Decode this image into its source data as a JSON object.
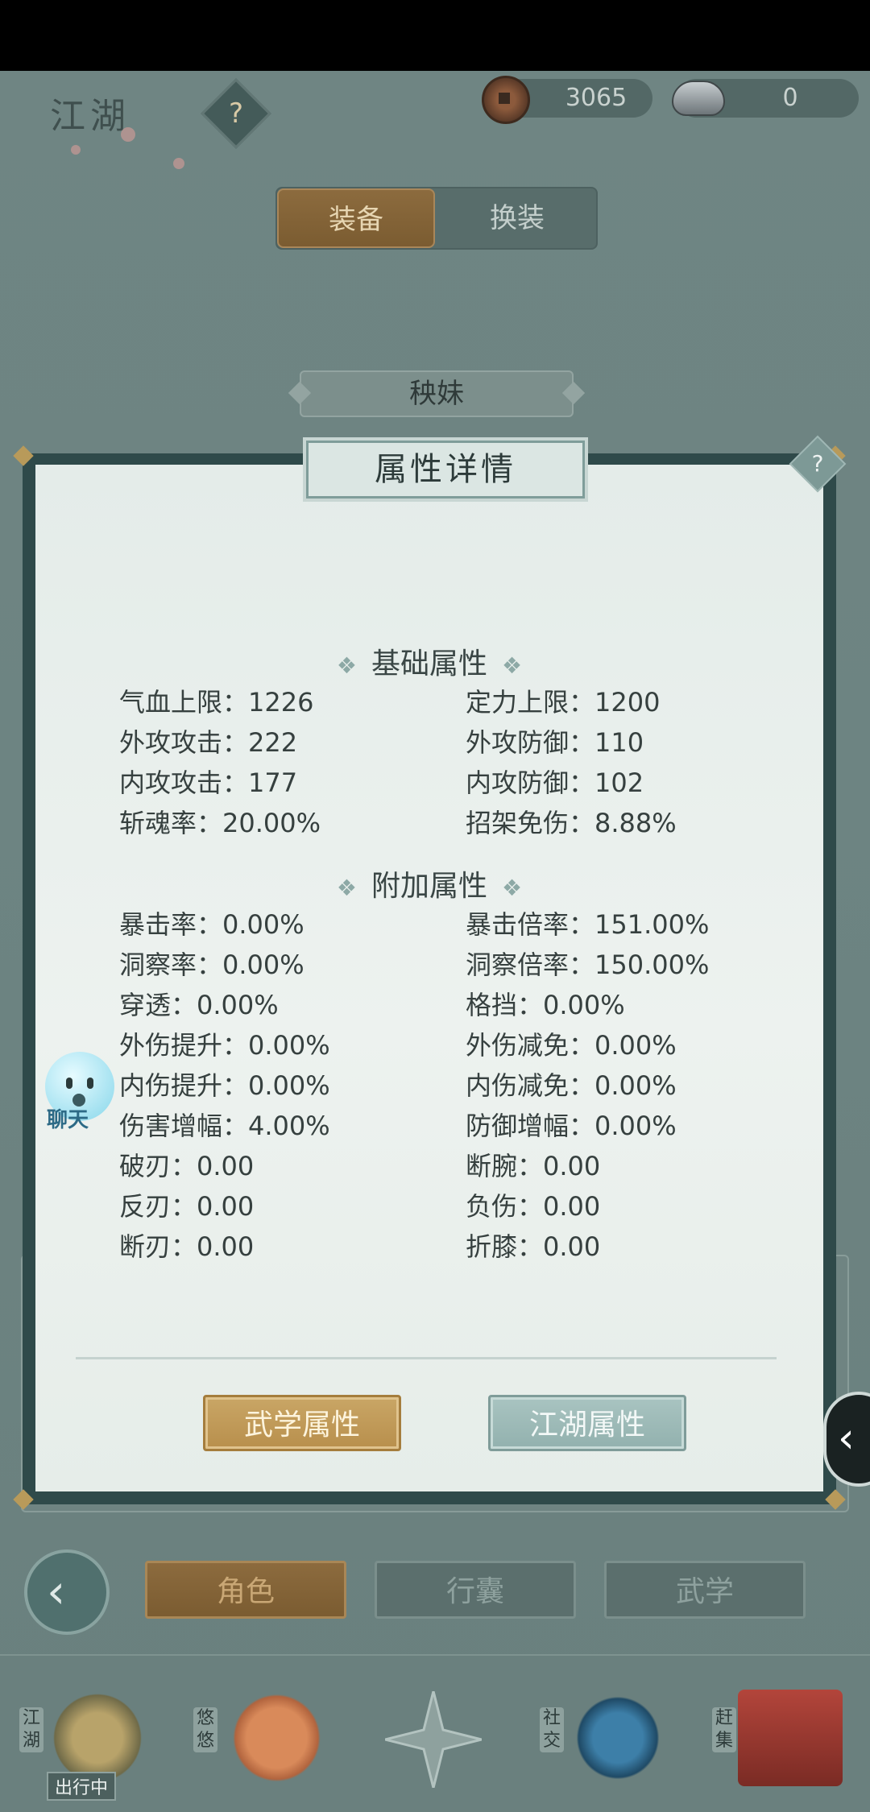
{
  "header": {
    "title": "江湖",
    "help_icon": "?",
    "copper": "3065",
    "silver": "0"
  },
  "tabs": [
    {
      "label": "装备",
      "active": true
    },
    {
      "label": "换装",
      "active": false
    }
  ],
  "character_name": "秧妹",
  "modal": {
    "title": "属性详情",
    "help": "?",
    "basic_title": "基础属性",
    "basic_stats": [
      {
        "label": "气血上限：1226"
      },
      {
        "label": "定力上限：1200"
      },
      {
        "label": "外攻攻击：222"
      },
      {
        "label": "外攻防御：110"
      },
      {
        "label": "内攻攻击：177"
      },
      {
        "label": "内攻防御：102"
      },
      {
        "label": "斩魂率：20.00%"
      },
      {
        "label": "招架免伤：8.88%"
      }
    ],
    "extra_title": "附加属性",
    "extra_stats": [
      {
        "label": "暴击率：0.00%"
      },
      {
        "label": "暴击倍率：151.00%"
      },
      {
        "label": "洞察率：0.00%"
      },
      {
        "label": "洞察倍率：150.00%"
      },
      {
        "label": "穿透：0.00%"
      },
      {
        "label": "格挡：0.00%"
      },
      {
        "label": "外伤提升：0.00%"
      },
      {
        "label": "外伤减免：0.00%"
      },
      {
        "label": "内伤提升：0.00%"
      },
      {
        "label": "内伤减免：0.00%"
      },
      {
        "label": "伤害增幅：4.00%"
      },
      {
        "label": "防御增幅：0.00%"
      },
      {
        "label": "破刃：0.00"
      },
      {
        "label": "断腕：0.00"
      },
      {
        "label": "反刃：0.00"
      },
      {
        "label": "负伤：0.00"
      },
      {
        "label": "断刃：0.00"
      },
      {
        "label": "折膝：0.00"
      }
    ],
    "button_martial": "武学属性",
    "button_jianghu": "江湖属性"
  },
  "chat": {
    "label": "聊天"
  },
  "nav": [
    {
      "label": "角色",
      "active": true
    },
    {
      "label": "行囊",
      "active": false
    },
    {
      "label": "武学",
      "active": false
    }
  ],
  "dock": [
    {
      "label": "江湖",
      "status": "出行中"
    },
    {
      "label": "悠悠"
    },
    {
      "label": "社交"
    },
    {
      "label": "赶集"
    }
  ],
  "colors": {
    "gold_button": "#c9a666",
    "teal_button": "#a9c4c1",
    "panel": "#e4ece9"
  }
}
